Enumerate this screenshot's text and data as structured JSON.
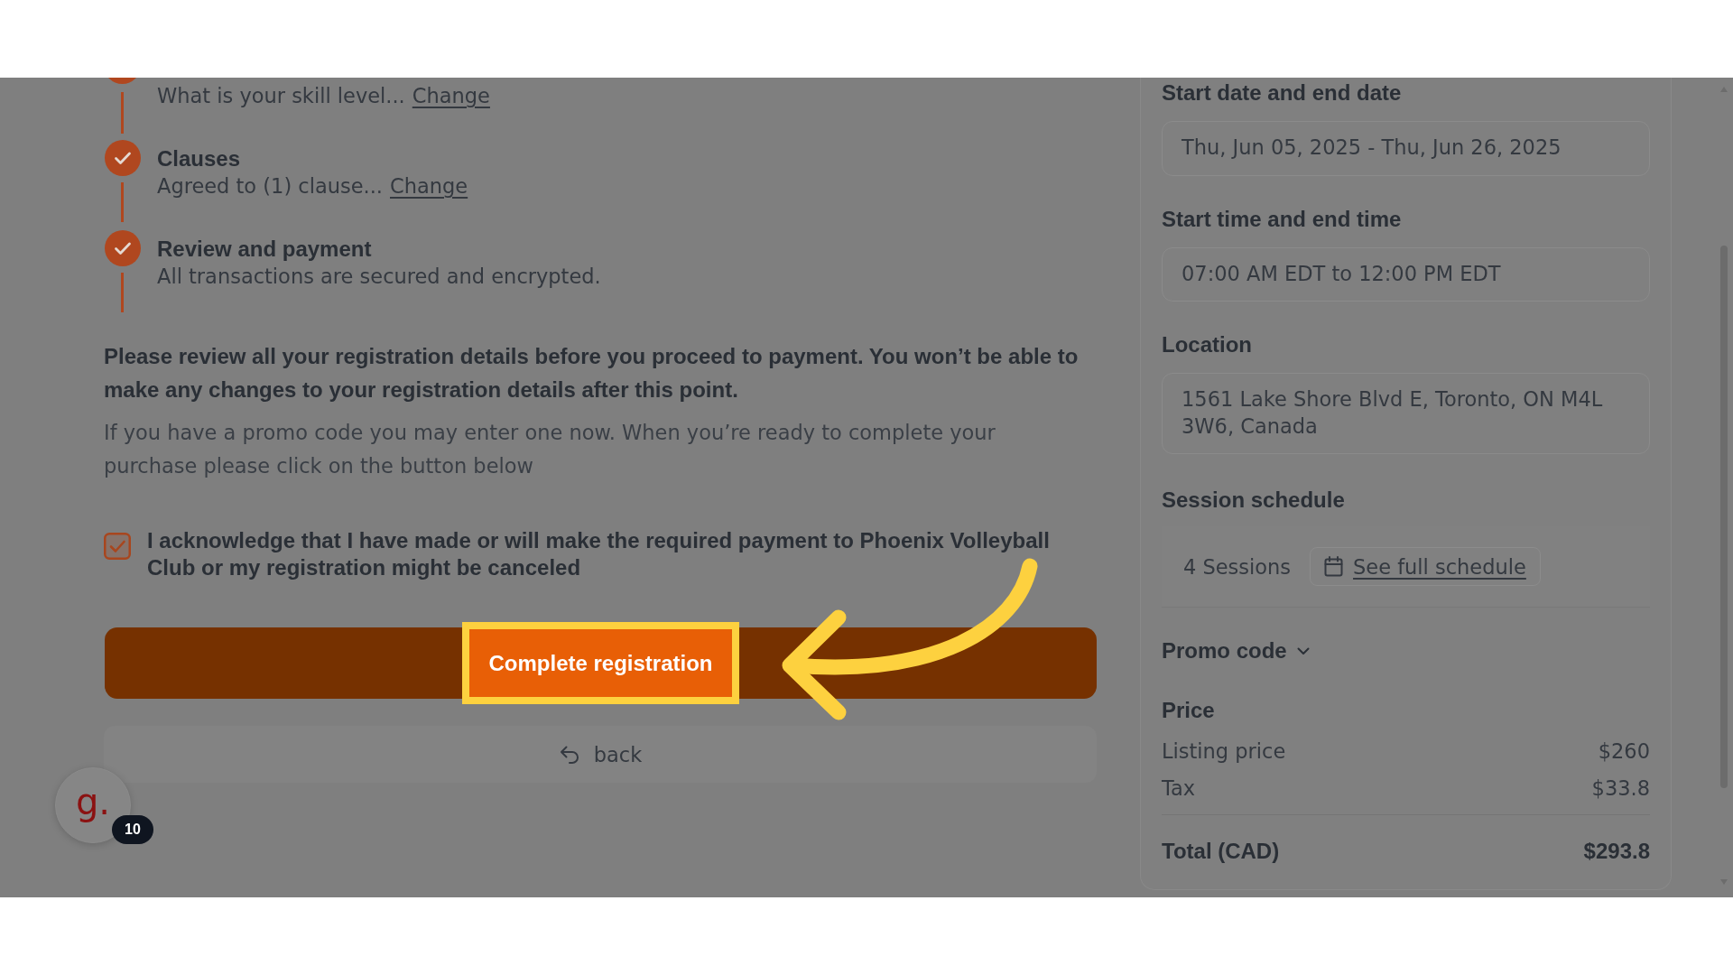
{
  "main": {
    "steps": [
      {
        "description": "What is your skill level...",
        "link": "Change",
        "completed": true
      },
      {
        "title": "Clauses",
        "description": "Agreed to (1) clause...",
        "link": "Change",
        "completed": true
      },
      {
        "title": "Review and payment",
        "description": "All transactions are secured and encrypted.",
        "completed": true
      }
    ],
    "notice": "Please review all your registration details before you proceed to payment. You won’t be able to make any changes to your registration details after this point.",
    "instructions": "If you have a promo code you may enter one now. When you’re ready to complete your purchase please click on the button below",
    "acknowledgement": {
      "label": "I acknowledge that I have made or will make the required payment to Phoenix Volleyball Club or my registration might be canceled",
      "checked": true
    },
    "complete_button": {
      "label": "Complete registration"
    },
    "back_button": {
      "label": "back"
    }
  },
  "summary": {
    "fields": [
      {
        "label": "Start date and end date",
        "value": "Thu, Jun 05, 2025 - Thu, Jun 26, 2025"
      },
      {
        "label": "Start time and end time",
        "value": "07:00 AM EDT to 12:00 PM EDT"
      },
      {
        "label": "Location",
        "value": "1561 Lake Shore Blvd E, Toronto, ON M4L 3W6, Canada"
      }
    ],
    "session_schedule": {
      "label": "Session schedule",
      "count": "4 Sessions",
      "link": "See full schedule"
    },
    "promo_code": {
      "label": "Promo code",
      "expanded": false
    },
    "price": {
      "title": "Price",
      "rows": [
        {
          "label": "Listing price",
          "amount": "$260"
        },
        {
          "label": "Tax",
          "amount": "$33.8"
        }
      ],
      "total": {
        "label": "Total (CAD)",
        "amount": "$293.8"
      }
    }
  },
  "help_widget": {
    "logo": "g.",
    "badge": "10"
  }
}
